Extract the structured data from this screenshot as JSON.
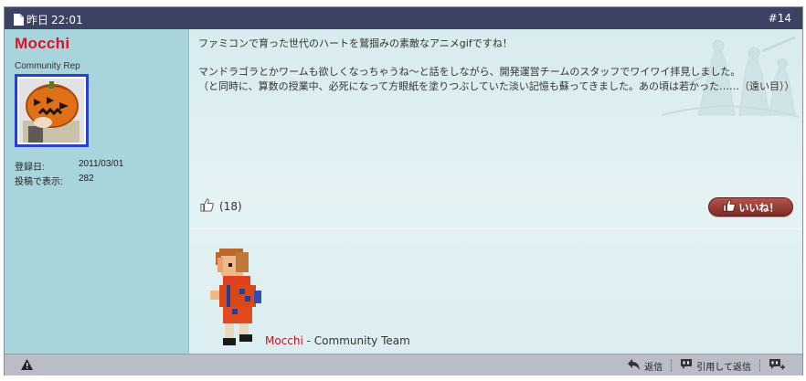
{
  "header": {
    "date_text": "昨日",
    "time_text": "22:01",
    "post_number": "#14"
  },
  "user": {
    "name": "Mocchi",
    "title": "Community Rep",
    "stats": [
      {
        "label": "登録日:",
        "value": "2011/03/01"
      },
      {
        "label": "投稿で表示:",
        "value": "282"
      }
    ]
  },
  "message": {
    "line1": "ファミコンで育った世代のハートを鷲掴みの素敵なアニメgifですね！",
    "line2": "マンドラゴラとかワームも欲しくなっちゃうね～と話をしながら、開発運営チームのスタッフでワイワイ拝見しました。",
    "line3": "（と同時に、算数の授業中、必死になって方眼紙を塗りつぶしていた淡い記憶も蘇ってきました。あの頃は若かった……（遠い目））"
  },
  "likes": {
    "count_text": "(18)",
    "button_label": "いいね！"
  },
  "signature": {
    "name": "Mocchi",
    "suffix": " - Community Team"
  },
  "footer": {
    "reply_label": "返信",
    "quote_label": "引用して返信",
    "icons": [
      "warning-icon",
      "reply-icon",
      "quote-icon",
      "multiquote-icon"
    ]
  },
  "colors": {
    "header_bg": "#3c4262",
    "sidebar_bg": "#a8d4dc",
    "username": "#e0102a",
    "like_button": "#8f3a32",
    "footer_bg": "#babcc8"
  }
}
